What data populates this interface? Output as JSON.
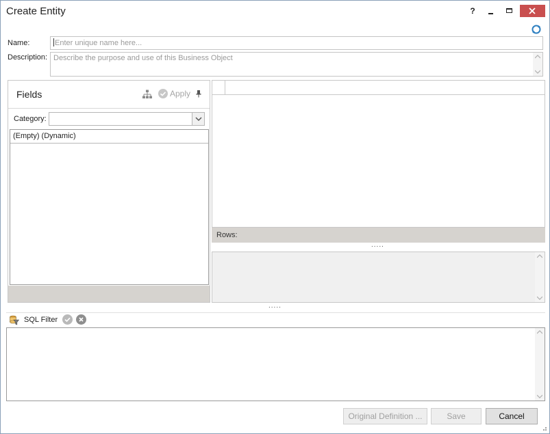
{
  "window": {
    "title": "Create Entity",
    "help_label": "?",
    "close_color": "#c94f4f"
  },
  "form": {
    "name_label": "Name:",
    "name_placeholder": "Enter unique name here...",
    "description_label": "Description:",
    "description_placeholder": "Describe the purpose and use of this Business Object"
  },
  "fields_panel": {
    "title": "Fields",
    "apply_label": "Apply",
    "category_label": "Category:",
    "category_value": "",
    "items": [
      {
        "label": "(Empty) (Dynamic)"
      }
    ]
  },
  "grid": {
    "rows_label": "Rows:"
  },
  "splitters": {
    "dots": "....."
  },
  "sql_filter": {
    "label": "SQL Filter"
  },
  "buttons": {
    "original_definition": "Original Definition ...",
    "save": "Save",
    "cancel": "Cancel"
  },
  "icons": {
    "refresh": "refresh-icon",
    "hierarchy": "hierarchy-icon",
    "pin": "pin-icon",
    "sql_filter": "filter-icon",
    "apply": "check-circle-icon",
    "clear": "clear-circle-icon"
  }
}
